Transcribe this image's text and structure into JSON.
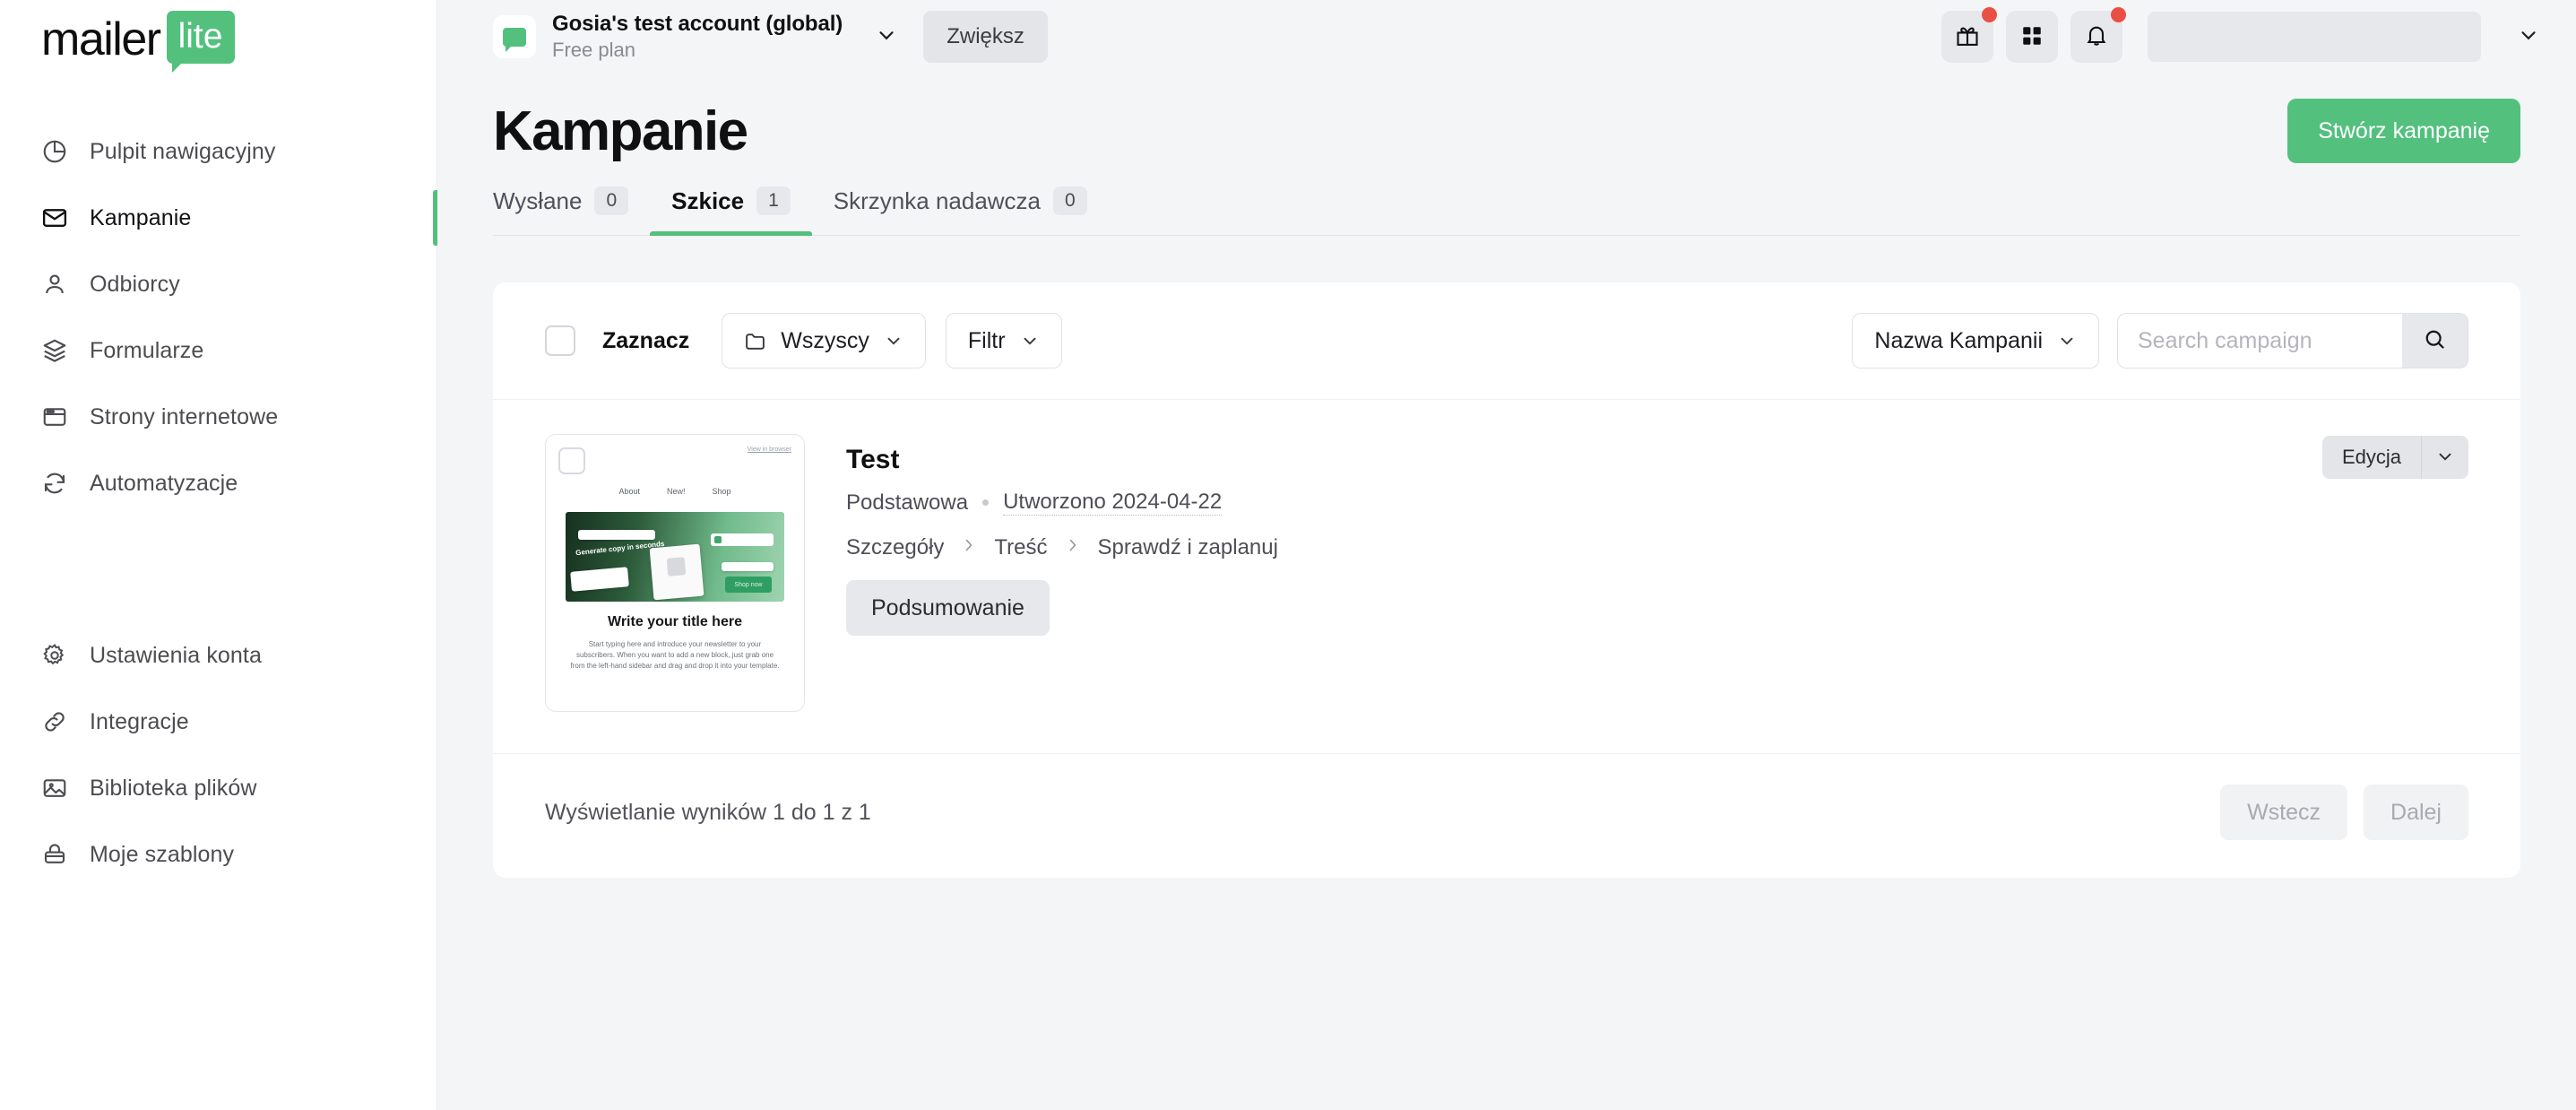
{
  "brand": {
    "logo_word": "mailer",
    "logo_badge": "lite",
    "green": "#53c07e",
    "red": "#ea4f44"
  },
  "sidebar": {
    "primary_items": [
      {
        "label": "Pulpit nawigacyjny",
        "icon": "pie-chart-icon",
        "active": false
      },
      {
        "label": "Kampanie",
        "icon": "envelope-icon",
        "active": true
      },
      {
        "label": "Odbiorcy",
        "icon": "person-icon",
        "active": false
      },
      {
        "label": "Formularze",
        "icon": "layers-icon",
        "active": false
      },
      {
        "label": "Strony internetowe",
        "icon": "browser-window-icon",
        "active": false
      },
      {
        "label": "Automatyzacje",
        "icon": "refresh-icon",
        "active": false
      }
    ],
    "secondary_items": [
      {
        "label": "Ustawienia konta",
        "icon": "gear-icon"
      },
      {
        "label": "Integracje",
        "icon": "link-icon"
      },
      {
        "label": "Biblioteka plików",
        "icon": "image-icon"
      },
      {
        "label": "Moje szablony",
        "icon": "template-icon"
      }
    ]
  },
  "topbar": {
    "account_name": "Gosia's test account (global)",
    "account_plan": "Free plan",
    "upgrade_label": "Zwiększ",
    "icons": [
      {
        "name": "gift-icon",
        "badge": true
      },
      {
        "name": "apps-grid-icon",
        "badge": false
      },
      {
        "name": "bell-icon",
        "badge": true
      }
    ]
  },
  "page": {
    "title": "Kampanie",
    "create_label": "Stwórz kampanię"
  },
  "tabs": [
    {
      "label": "Wysłane",
      "count": "0",
      "active": false
    },
    {
      "label": "Szkice",
      "count": "1",
      "active": true
    },
    {
      "label": "Skrzynka nadawcza",
      "count": "0",
      "active": false
    }
  ],
  "toolbar": {
    "select_label": "Zaznacz",
    "folder_label": "Wszyscy",
    "filter_label": "Filtr",
    "sort_label": "Nazwa Kampanii",
    "search_placeholder": "Search campaign",
    "search_value": ""
  },
  "campaign": {
    "name": "Test",
    "type": "Podstawowa",
    "created": "Utworzono 2024-04-22",
    "steps": [
      {
        "label": "Szczegóły"
      },
      {
        "label": "Treść"
      },
      {
        "label": "Sprawdź i zaplanuj"
      }
    ],
    "summary_label": "Podsumowanie",
    "edit_label": "Edycja",
    "thumbnail": {
      "view_in_browser": "View in browser",
      "nav": [
        "About",
        "New!",
        "Shop"
      ],
      "hero_copy": "Generate copy in seconds",
      "hero_cta": "Shop now",
      "title": "Write your title here",
      "body": "Start typing here and introduce your newsletter to your subscribers. When you want to add a new block, just grab one from the left-hand sidebar and drag and drop it into your template."
    }
  },
  "footer": {
    "results_text": "Wyświetlanie wyników 1 do 1 z 1",
    "prev_label": "Wstecz",
    "next_label": "Dalej"
  }
}
